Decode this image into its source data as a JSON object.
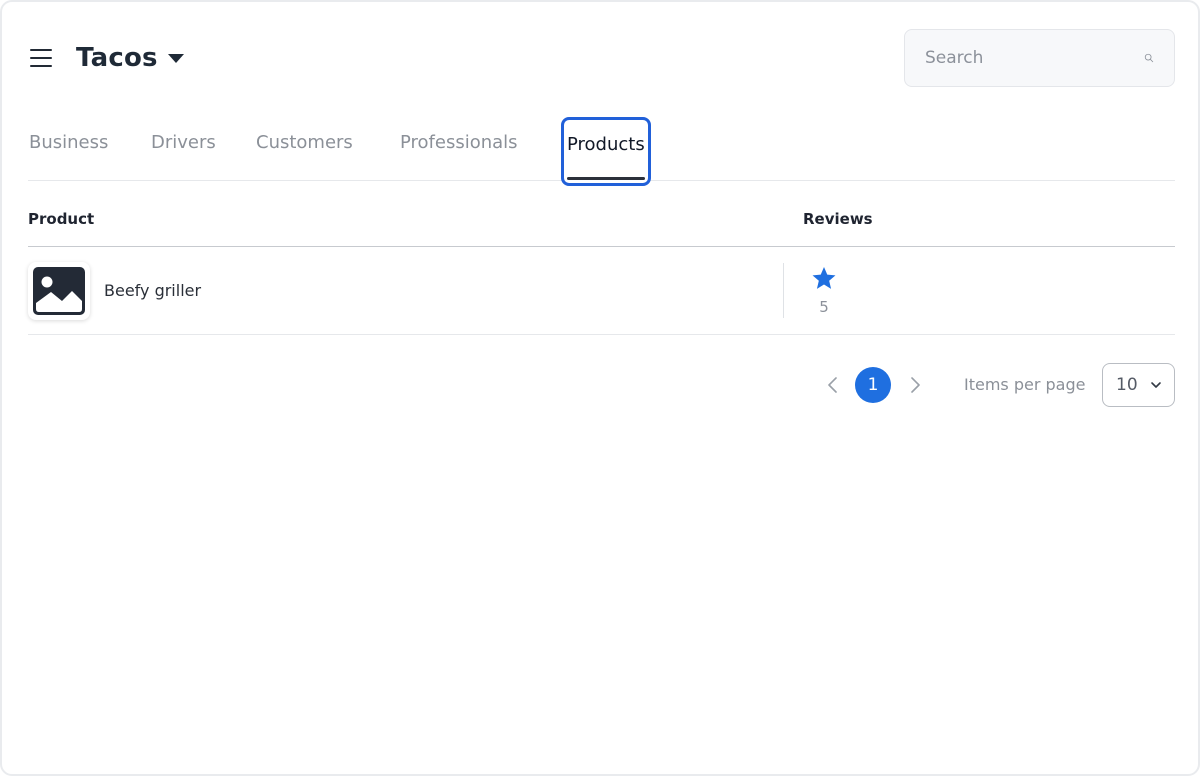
{
  "header": {
    "title": "Tacos",
    "search_placeholder": "Search"
  },
  "tabs": [
    {
      "label": "Business",
      "active": false
    },
    {
      "label": "Drivers",
      "active": false
    },
    {
      "label": "Customers",
      "active": false
    },
    {
      "label": "Professionals",
      "active": false
    },
    {
      "label": "Products",
      "active": true
    }
  ],
  "table": {
    "columns": [
      "Product",
      "Reviews"
    ],
    "rows": [
      {
        "name": "Beefy griller",
        "rating": "5",
        "thumbnail_icon": "image-placeholder-icon"
      }
    ]
  },
  "pagination": {
    "current_page": "1",
    "items_per_page_label": "Items per page",
    "items_per_page": "10"
  },
  "colors": {
    "accent": "#1f6fe0",
    "tab_highlight": "#2160d9",
    "star": "#1f6fe0"
  }
}
